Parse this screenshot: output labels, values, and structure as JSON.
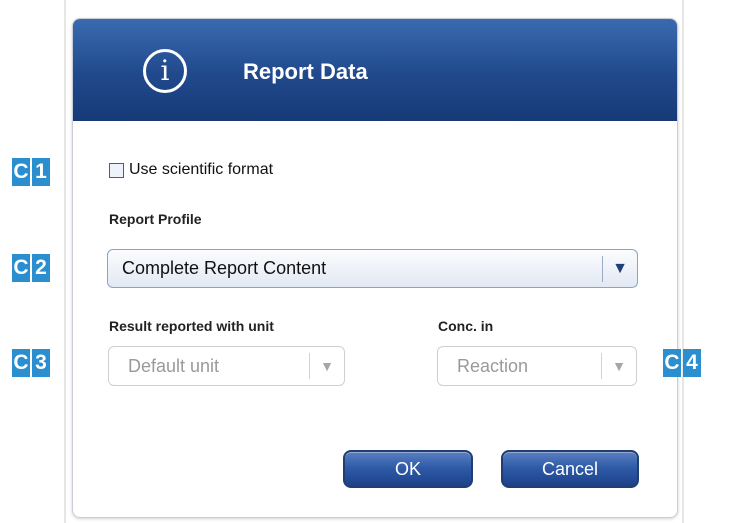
{
  "dialog": {
    "title": "Report Data",
    "info_icon": "info-circle-icon"
  },
  "callouts": [
    {
      "letter": "C",
      "number": "1"
    },
    {
      "letter": "C",
      "number": "2"
    },
    {
      "letter": "C",
      "number": "3"
    },
    {
      "letter": "C",
      "number": "4"
    }
  ],
  "scientific_format": {
    "label": "Use scientific format",
    "checked": false
  },
  "report_profile": {
    "label": "Report Profile",
    "value": "Complete Report Content"
  },
  "result_unit": {
    "label": "Result reported with unit",
    "value": "Default unit",
    "enabled": false
  },
  "conc_in": {
    "label": "Conc. in",
    "value": "Reaction",
    "enabled": false
  },
  "buttons": {
    "ok": "OK",
    "cancel": "Cancel"
  },
  "colors": {
    "titlebar": "#20498c",
    "callout": "#2a8ecf",
    "button": "#2f5ba8"
  }
}
